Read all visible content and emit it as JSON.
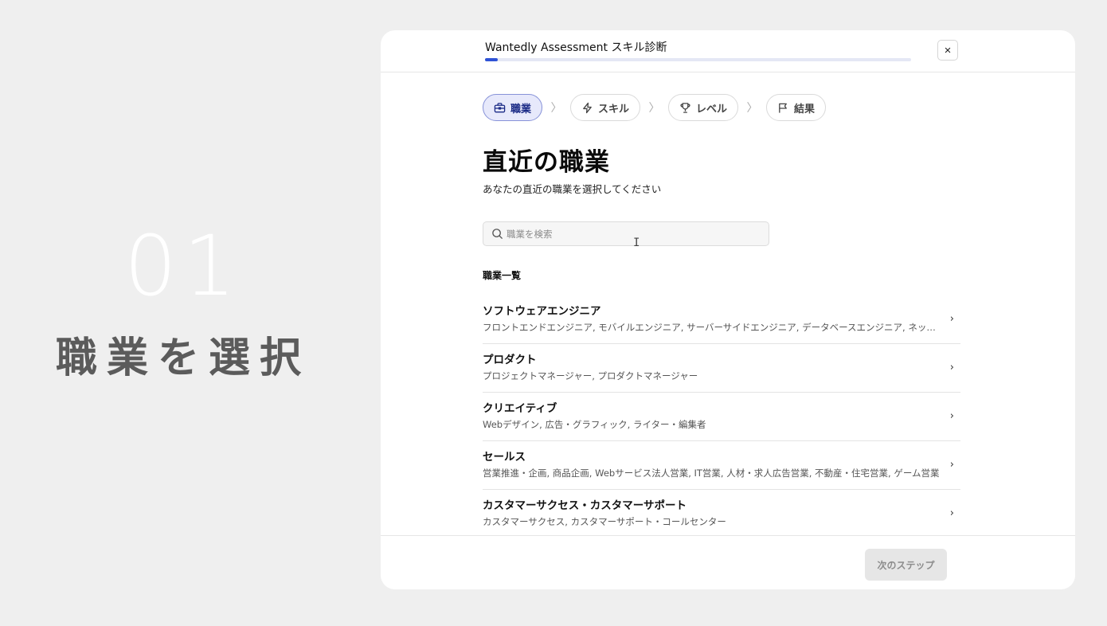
{
  "hero": {
    "number": "01",
    "title": "職業を選択"
  },
  "modal": {
    "title": "Wantedly Assessment スキル診断",
    "progress": 0.03,
    "close_label": "×",
    "steps": [
      {
        "label": "職業",
        "icon": "briefcase-icon",
        "active": true
      },
      {
        "label": "スキル",
        "icon": "lightning-icon",
        "active": false
      },
      {
        "label": "レベル",
        "icon": "trophy-icon",
        "active": false
      },
      {
        "label": "結果",
        "icon": "flag-icon",
        "active": false
      }
    ],
    "step_separator": "〉",
    "heading": "直近の職業",
    "subheading": "あなたの直近の職業を選択してください",
    "search": {
      "placeholder": "職業を検索",
      "value": ""
    },
    "list_heading": "職業一覧",
    "jobs": [
      {
        "name": "ソフトウェアエンジニア",
        "description": "フロントエンドエンジニア, モバイルエンジニア, サーバーサイドエンジニア, データベースエンジニア, ネットワ…"
      },
      {
        "name": "プロダクト",
        "description": "プロジェクトマネージャー, プロダクトマネージャー"
      },
      {
        "name": "クリエイティブ",
        "description": "Webデザイン, 広告・グラフィック, ライター・編集者"
      },
      {
        "name": "セールス",
        "description": "営業推進・企画, 商品企画, Webサービス法人営業, IT営業, 人材・求人広告営業, 不動産・住宅営業, ゲーム営業"
      },
      {
        "name": "カスタマーサクセス・カスタマーサポート",
        "description": "カスタマーサクセス, カスタマーサポート・コールセンター"
      }
    ],
    "row_chevron": "›",
    "next_button": "次のステップ"
  }
}
